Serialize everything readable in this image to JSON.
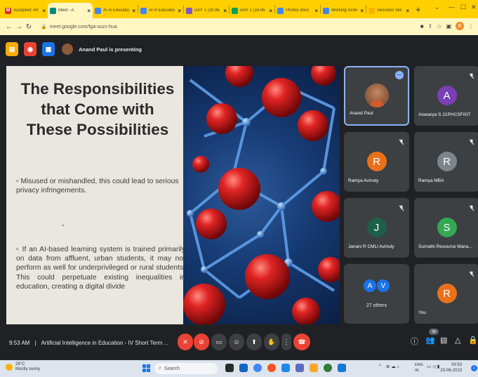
{
  "browser": {
    "tabs": [
      {
        "label": "Accepted: Art",
        "icon_color": "#d93025",
        "icon_text": "M",
        "active": false
      },
      {
        "label": "Meet - A",
        "icon_color": "#00897b",
        "icon_text": "",
        "active": true
      },
      {
        "label": "AI in Educatio",
        "icon_color": "#4285f4",
        "icon_text": "",
        "active": false
      },
      {
        "label": "AI in Educatio",
        "icon_color": "#4285f4",
        "icon_text": "",
        "active": false
      },
      {
        "label": "DAY 1 (19.06.",
        "icon_color": "#7e57c2",
        "icon_text": "",
        "active": false
      },
      {
        "label": "DAY 1 (19.06.",
        "icon_color": "#0f9d58",
        "icon_text": "",
        "active": false
      },
      {
        "label": "Photos docx",
        "icon_color": "#4285f4",
        "icon_text": "",
        "active": false
      },
      {
        "label": "Working Sche",
        "icon_color": "#4285f4",
        "icon_text": "",
        "active": false
      },
      {
        "label": "Sessions Slic",
        "icon_color": "#f4b400",
        "icon_text": "",
        "active": false
      }
    ],
    "url": "meet.google.com/fga-suzc-hua"
  },
  "meet": {
    "presenting_text": "Anand Paul is presenting",
    "slide": {
      "title": "The Responsibilities that Come with These Possibilities",
      "bullet1": "Misused or mishandled, this could lead to serious privacy infringements.",
      "bullet2": "If an AI-based learning system is trained primarily on data from affluent, urban students, it may not perform as well for underprivileged or rural students. This could perpetuate existing inequalities in education, creating a digital divide"
    },
    "participants": [
      {
        "name": "Anand Paul",
        "initial": "",
        "avatar_color": "",
        "photo": true
      },
      {
        "name": "Aiswarya S 21PHCSF007",
        "initial": "A",
        "avatar_color": "#7b3fb5"
      },
      {
        "name": "Ramya Avinuty",
        "initial": "R",
        "avatar_color": "#e8711a"
      },
      {
        "name": "Ramya MBA",
        "initial": "R",
        "avatar_color": "#7e868c"
      },
      {
        "name": "Janani R CMLI Avinuty",
        "initial": "J",
        "avatar_color": "#1e5f4a"
      },
      {
        "name": "Sumathi Resource Mana...",
        "initial": "S",
        "avatar_color": "#34a853"
      },
      {
        "name": "27 others",
        "initials": [
          "A",
          "V"
        ],
        "avatar_colors": [
          "#1a73e8",
          "#1a73e8"
        ]
      },
      {
        "name": "You",
        "initial": "R",
        "avatar_color": "#e8711a"
      }
    ],
    "footer": {
      "time": "9:53 AM",
      "separator": "|",
      "meeting_title": "Artificial Intelligence in Education - IV Short Term ...",
      "participant_count": "36"
    }
  },
  "taskbar": {
    "weather_temp": "26°C",
    "weather_desc": "Mostly sunny",
    "search_placeholder": "Search",
    "lang_line1": "ENG",
    "lang_line2": "IN",
    "time": "09:53",
    "date": "23-06-2023",
    "notification_count": "1"
  },
  "colors": {
    "chrome_yellow": "#ffcf00",
    "meet_bg": "#202124",
    "tile_bg": "#3c4043",
    "end_call_red": "#ea4335",
    "muted_red": "#ea4335"
  }
}
